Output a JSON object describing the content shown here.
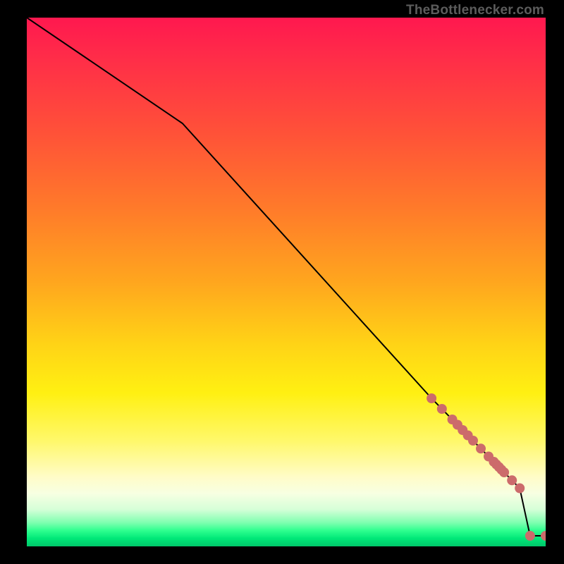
{
  "attribution": "TheBottlenecker.com",
  "colors": {
    "line": "#000000",
    "marker": "#cc6b6b"
  },
  "chart_data": {
    "type": "line",
    "title": "",
    "xlabel": "",
    "ylabel": "",
    "xlim": [
      0,
      100
    ],
    "ylim": [
      0,
      100
    ],
    "x": [
      0,
      30,
      78,
      80,
      82,
      83,
      84,
      85,
      86,
      87.5,
      89,
      90,
      90.5,
      91,
      91.5,
      92,
      93.5,
      95,
      97,
      100
    ],
    "values": [
      100,
      80,
      28,
      26,
      24,
      23,
      22,
      21,
      20,
      18.5,
      17,
      16,
      15.5,
      15,
      14.5,
      14,
      12.5,
      11,
      2,
      2
    ],
    "marker_points": {
      "x": [
        78,
        80,
        82,
        83,
        84,
        85,
        86,
        87.5,
        89,
        90,
        90.5,
        91,
        91.5,
        92,
        93.5,
        95,
        97,
        100
      ],
      "y": [
        28,
        26,
        24,
        23,
        22,
        21,
        20,
        18.5,
        17,
        16,
        15.5,
        15,
        14.5,
        14,
        12.5,
        11,
        2,
        2
      ]
    }
  }
}
